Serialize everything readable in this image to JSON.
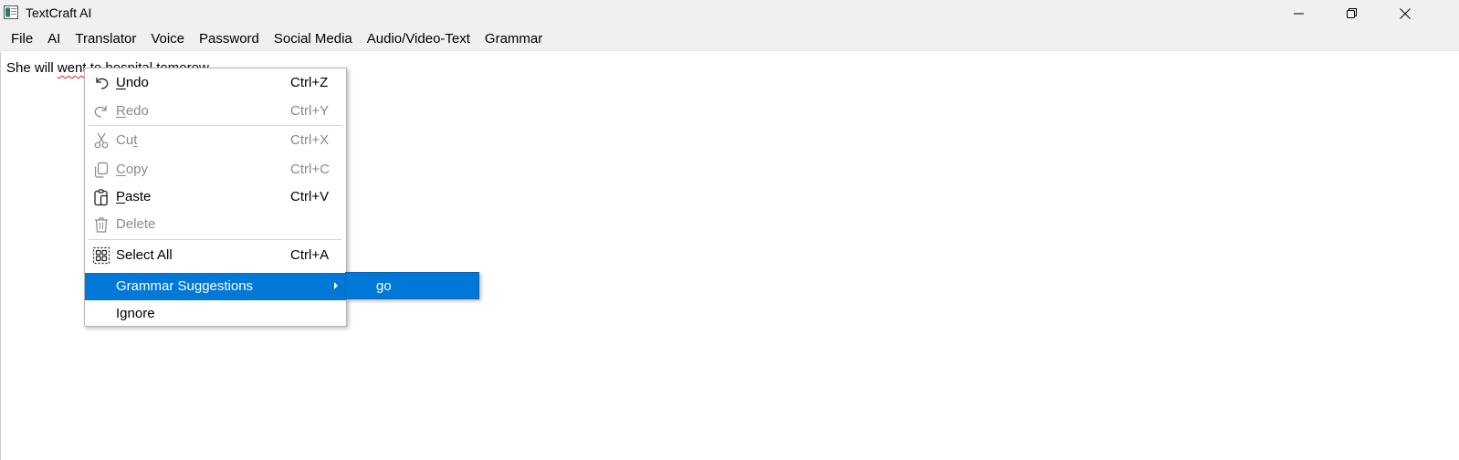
{
  "window": {
    "title": "TextCraft AI",
    "icons": {
      "app": "notepad-app-icon",
      "minimize": "minimize-icon",
      "maximize": "restore-icon",
      "close": "close-icon"
    }
  },
  "menubar": {
    "items": [
      "File",
      "AI",
      "Translator",
      "Voice",
      "Password",
      "Social Media",
      "Audio/Video-Text",
      "Grammar"
    ]
  },
  "editor": {
    "text_before": "She will ",
    "text_error": "went",
    "text_after": " to hospital tomorow"
  },
  "context_menu": {
    "items": [
      {
        "key": "undo",
        "mnemonic": "U",
        "rest": "ndo",
        "shortcut": "Ctrl+Z",
        "icon": "undo-icon",
        "enabled": true
      },
      {
        "key": "redo",
        "mnemonic": "R",
        "rest": "edo",
        "shortcut": "Ctrl+Y",
        "icon": "redo-icon",
        "enabled": false
      },
      {
        "key": "cut",
        "prefix": "Cu",
        "mnemonic": "t",
        "shortcut": "Ctrl+X",
        "icon": "scissors-icon",
        "enabled": false
      },
      {
        "key": "copy",
        "mnemonic": "C",
        "rest": "opy",
        "shortcut": "Ctrl+C",
        "icon": "copy-icon",
        "enabled": false
      },
      {
        "key": "paste",
        "mnemonic": "P",
        "rest": "aste",
        "shortcut": "Ctrl+V",
        "icon": "paste-icon",
        "enabled": true
      },
      {
        "key": "delete",
        "label": "Delete",
        "icon": "trash-icon",
        "enabled": false
      },
      {
        "key": "select_all",
        "label": "Select All",
        "shortcut": "Ctrl+A",
        "icon": "select-all-icon",
        "enabled": true
      },
      {
        "key": "grammar",
        "label": "Grammar Suggestions",
        "enabled": true,
        "selected": true,
        "has_submenu": true
      },
      {
        "key": "ignore",
        "label": "Ignore",
        "enabled": true
      }
    ],
    "highlight_color": "#0078d7"
  },
  "submenu": {
    "items": [
      "go"
    ]
  }
}
